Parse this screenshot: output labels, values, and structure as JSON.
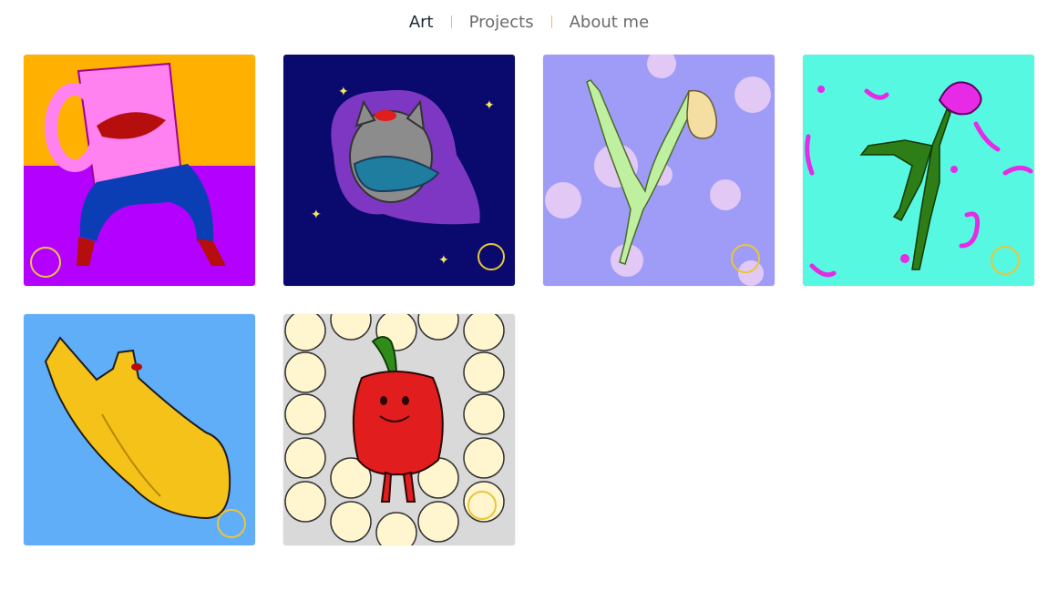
{
  "nav": {
    "items": [
      {
        "label": "Art",
        "active": true
      },
      {
        "label": "Projects",
        "active": false
      },
      {
        "label": "About me",
        "active": false
      }
    ],
    "separator_color": "#e8c63a"
  },
  "gallery": {
    "items": [
      {
        "name": "mug-lips-artwork",
        "bg": [
          "#ffb000",
          "#b400ff"
        ]
      },
      {
        "name": "space-cat-artwork",
        "bg": [
          "#0a0a6e"
        ]
      },
      {
        "name": "dancer-bulb-artwork",
        "bg": [
          "#9f9cf7"
        ]
      },
      {
        "name": "flower-dancer-artwork",
        "bg": [
          "#57f8e2"
        ]
      },
      {
        "name": "yellow-hand-artwork",
        "bg": [
          "#60aef7"
        ]
      },
      {
        "name": "red-pepper-artwork",
        "bg": [
          "#d9d9d9"
        ]
      }
    ]
  }
}
